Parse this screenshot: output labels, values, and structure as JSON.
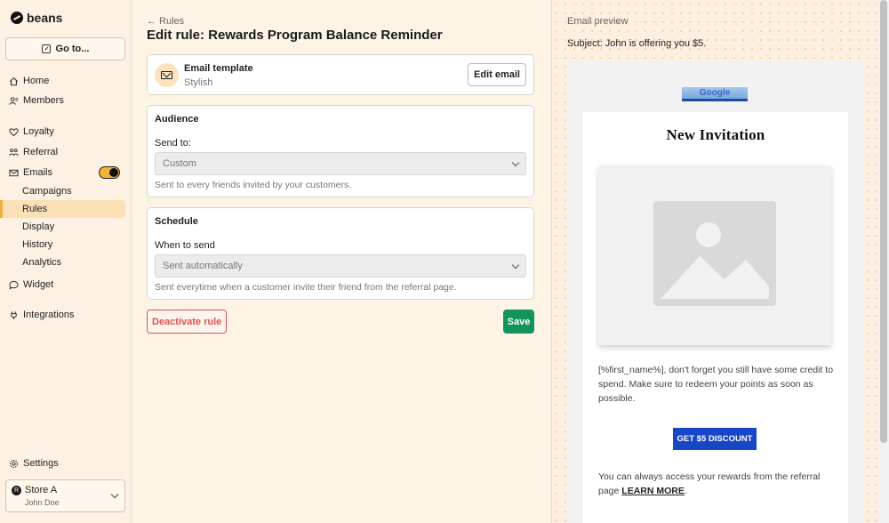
{
  "app": {
    "logo_text": "beans",
    "goto_label": "Go to..."
  },
  "sidebar": {
    "items": [
      {
        "label": "Home",
        "icon": "home-icon"
      },
      {
        "label": "Members",
        "icon": "members-icon"
      },
      {
        "label": "Loyalty",
        "icon": "heart-icon"
      },
      {
        "label": "Referral",
        "icon": "referral-icon"
      },
      {
        "label": "Emails",
        "icon": "mail-icon",
        "toggle": true
      }
    ],
    "email_subitems": [
      "Campaigns",
      "Rules",
      "Display",
      "History",
      "Analytics"
    ],
    "active_subitem": "Rules",
    "items2": [
      {
        "label": "Widget",
        "icon": "chat-icon"
      },
      {
        "label": "Integrations",
        "icon": "plug-icon"
      }
    ],
    "settings_label": "Settings",
    "store": {
      "name": "Store A",
      "user": "John Doe",
      "avatar_letter": "R"
    }
  },
  "main": {
    "back_label": "← Rules",
    "title": "Edit rule: Rewards Program Balance Reminder",
    "template": {
      "label": "Email template",
      "value": "Stylish",
      "edit_label": "Edit email"
    },
    "audience": {
      "heading": "Audience",
      "field_label": "Send to:",
      "selected": "Custom",
      "help": "Sent to every friends invited by your customers."
    },
    "schedule": {
      "heading": "Schedule",
      "field_label": "When to send",
      "selected": "Sent automatically",
      "help": "Sent everytime when a customer invite their friend from the referral page."
    },
    "deactivate_label": "Deactivate rule",
    "save_label": "Save"
  },
  "preview": {
    "label": "Email preview",
    "subject": "Subject: John is offering you $5.",
    "banner_text": "Google",
    "heading": "New Invitation",
    "body": "[%first_name%], don't forget you still have some credit to spend. Make sure to redeem your points as soon as possible.",
    "cta_label": "GET $5 DISCOUNT",
    "footer_text": "You can always access your rewards from the referral page",
    "footer_link": "LEARN MORE",
    "footer_end": "."
  },
  "colors": {
    "accent": "#f5b134",
    "save": "#12945a",
    "danger": "#d9534f",
    "cta": "#1746c6"
  }
}
